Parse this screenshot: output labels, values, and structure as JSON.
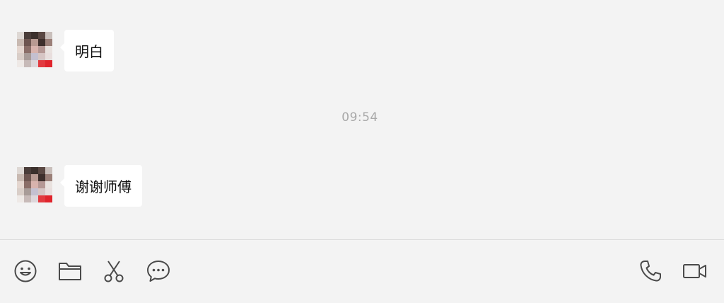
{
  "messages": [
    {
      "text": "明白"
    },
    {
      "text": "谢谢师傅"
    }
  ],
  "timestamp": "09:54",
  "toolbar": {
    "left_icons": [
      "emoji-icon",
      "folder-icon",
      "scissors-icon",
      "chat-bubble-icon"
    ],
    "right_icons": [
      "phone-icon",
      "video-camera-icon"
    ]
  },
  "colors": {
    "background": "#f3f3f3",
    "bubble": "#ffffff",
    "timestamp_text": "#a8a8a8",
    "icon_stroke": "#4a4a4a"
  }
}
